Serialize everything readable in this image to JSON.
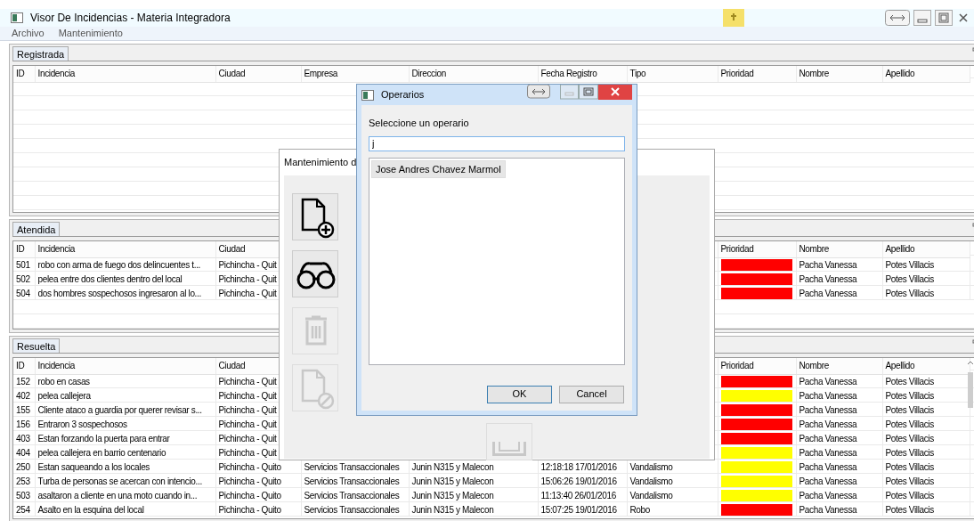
{
  "window": {
    "title": "Visor De Incidencias - Materia Integradora"
  },
  "menu": [
    "Archivo",
    "Mantenimiento"
  ],
  "panels": [
    {
      "tab": "Registrada",
      "columns": [
        {
          "kind": "id",
          "label": "ID"
        },
        {
          "kind": "incidencia",
          "label": "Incidencia"
        },
        {
          "kind": "ciudad",
          "label": "Ciudad"
        },
        {
          "kind": "empresa",
          "label": "Empresa"
        },
        {
          "kind": "direccion",
          "label": "Direccion"
        },
        {
          "kind": "fecha",
          "label": "Fecha Registro"
        },
        {
          "kind": "tipo",
          "label": "Tipo"
        },
        {
          "kind": "prioridad",
          "label": "Prioridad"
        },
        {
          "kind": "nombre",
          "label": "Nombre"
        },
        {
          "kind": "apellido",
          "label": "Apellido"
        }
      ]
    },
    {
      "tab": "Atendida",
      "columns": [
        {
          "kind": "id",
          "label": "ID"
        },
        {
          "kind": "incidencia",
          "label": "Incidencia"
        },
        {
          "kind": "ciudad",
          "label": "Ciudad"
        },
        {
          "kind": "prioridad",
          "label": "Prioridad"
        },
        {
          "kind": "nombre",
          "label": "Nombre"
        },
        {
          "kind": "apellido",
          "label": "Apellido"
        }
      ],
      "rows": [
        {
          "id": "501",
          "incidencia": "robo con arma de fuego dos delincuentes t...",
          "ciudad": "Pichincha - Quit",
          "color": "#ff0000",
          "nombre": "Pacha Vanessa",
          "apellido": "Potes Villacis"
        },
        {
          "id": "502",
          "incidencia": "pelea entre dos clientes dentro del local",
          "ciudad": "Pichincha - Quit",
          "color": "#ff0000",
          "nombre": "Pacha Vanessa",
          "apellido": "Potes Villacis"
        },
        {
          "id": "504",
          "incidencia": "dos hombres sospechosos ingresaron al lo...",
          "ciudad": "Pichincha - Quit",
          "color": "#ff0000",
          "nombre": "Pacha Vanessa",
          "apellido": "Potes Villacis"
        }
      ]
    },
    {
      "tab": "Resuelta",
      "columns": [
        {
          "kind": "id",
          "label": "ID"
        },
        {
          "kind": "incidencia",
          "label": "Incidencia"
        },
        {
          "kind": "ciudad",
          "label": "Ciudad"
        },
        {
          "kind": "prioridad",
          "label": "Prioridad"
        },
        {
          "kind": "nombre",
          "label": "Nombre"
        },
        {
          "kind": "apellido",
          "label": "Apellido"
        }
      ],
      "rows": [
        {
          "id": "152",
          "incidencia": "robo en casas",
          "ciudad": "Pichincha - Quit",
          "color": "#ff0000",
          "nombre": "Pacha Vanessa",
          "apellido": "Potes Villacis"
        },
        {
          "id": "402",
          "incidencia": "pelea callejera",
          "ciudad": "Pichincha - Quit",
          "color": "#ffff00",
          "nombre": "Pacha Vanessa",
          "apellido": "Potes Villacis"
        },
        {
          "id": "155",
          "incidencia": "Cliente ataco a guardia por querer revisar s...",
          "ciudad": "Pichincha - Quit",
          "color": "#ff0000",
          "nombre": "Pacha Vanessa",
          "apellido": "Potes Villacis"
        },
        {
          "id": "156",
          "incidencia": "Entraron 3 sospechosos",
          "ciudad": "Pichincha - Quit",
          "color": "#ff0000",
          "nombre": "Pacha Vanessa",
          "apellido": "Potes Villacis"
        },
        {
          "id": "403",
          "incidencia": "Estan forzando la puerta para entrar",
          "ciudad": "Pichincha - Quit",
          "color": "#ff0000",
          "nombre": "Pacha Vanessa",
          "apellido": "Potes Villacis"
        },
        {
          "id": "404",
          "incidencia": "pelea callejera en barrio centenario",
          "ciudad": "Pichincha - Quit",
          "color": "#ffff00",
          "nombre": "Pacha Vanessa",
          "apellido": "Potes Villacis"
        },
        {
          "id": "250",
          "incidencia": "Estan saqueando a los locales",
          "ciudad": "Pichincha - Quito",
          "empresa": "Servicios Transaccionales",
          "direccion": "Junin N315 y Malecon",
          "fecha": "12:18:18 17/01/2016",
          "tipo": "Vandalismo",
          "color": "#ffff00",
          "nombre": "Pacha Vanessa",
          "apellido": "Potes Villacis"
        },
        {
          "id": "253",
          "incidencia": "Turba de personas se acercan con intencio...",
          "ciudad": "Pichincha - Quito",
          "empresa": "Servicios Transaccionales",
          "direccion": "Junin N315 y Malecon",
          "fecha": "15:06:26 19/01/2016",
          "tipo": "Vandalismo",
          "color": "#ffff00",
          "nombre": "Pacha Vanessa",
          "apellido": "Potes Villacis"
        },
        {
          "id": "503",
          "incidencia": "asaltaron a cliente en una moto cuando in...",
          "ciudad": "Pichincha - Quito",
          "empresa": "Servicios Transaccionales",
          "direccion": "Junin N315 y Malecon",
          "fecha": "11:13:40 26/01/2016",
          "tipo": "Vandalismo",
          "color": "#ffff00",
          "nombre": "Pacha Vanessa",
          "apellido": "Potes Villacis"
        },
        {
          "id": "254",
          "incidencia": "Asalto en la esquina del local",
          "ciudad": "Pichincha - Quito",
          "empresa": "Servicios Transaccionales",
          "direccion": "Junin N315 y Malecon",
          "fecha": "15:07:25 19/01/2016",
          "tipo": "Robo",
          "color": "#ff0000",
          "nombre": "Pacha Vanessa",
          "apellido": "Potes Villacis"
        }
      ]
    }
  ],
  "maintenance": {
    "title": "Mantenimiento d",
    "tools": [
      {
        "kind": "add",
        "disabled": false
      },
      {
        "kind": "search",
        "disabled": false
      },
      {
        "kind": "delete",
        "disabled": true
      },
      {
        "kind": "cancel",
        "disabled": true
      },
      {
        "kind": "save",
        "disabled": true
      }
    ]
  },
  "dialog": {
    "title": "Operarios",
    "label": "Seleccione un operario",
    "value": "j",
    "items": [
      {
        "label": "Jose Andres Chavez Marmol",
        "selected": true
      }
    ],
    "buttons": [
      {
        "label": "OK",
        "default": true
      },
      {
        "label": "Cancel",
        "default": false
      }
    ]
  }
}
